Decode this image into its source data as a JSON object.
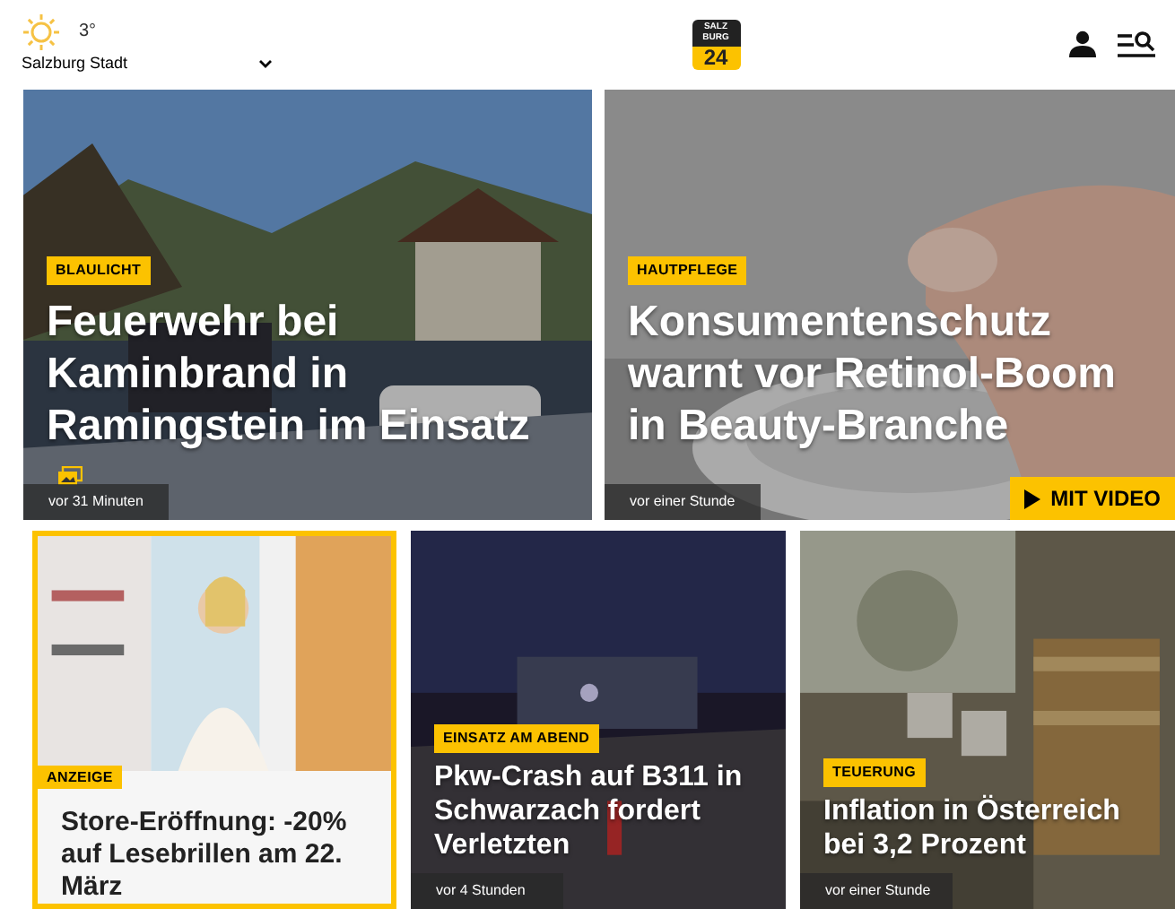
{
  "header": {
    "weather": {
      "temperature": "3°",
      "location": "Salzburg Stadt"
    },
    "logo": {
      "top": "SALZ",
      "middle": "BURG",
      "number": "24"
    }
  },
  "articles": [
    {
      "kind": "feature",
      "tag": "BLAULICHT",
      "title": "Feuerwehr bei Kaminbrand in Ramingstein im Einsatz",
      "time": "vor 31 Minuten",
      "gallery": true
    },
    {
      "kind": "feature",
      "tag": "HAUTPFLEGE",
      "title": "Konsumentenschutz warnt vor Retinol-Boom in Beauty-Branche",
      "time": "vor einer Stunde",
      "video": "MIT VIDEO"
    },
    {
      "kind": "ad",
      "tag": "ANZEIGE",
      "title": "Store-Eröffnung: -20% auf Lesebrillen am 22. März"
    },
    {
      "kind": "teaser",
      "tag": "EINSATZ AM ABEND",
      "title": "Pkw-Crash auf B311 in Schwarzach fordert Verletzten",
      "time": "vor 4 Stunden"
    },
    {
      "kind": "teaser",
      "tag": "TEUERUNG",
      "title": "Inflation in Österreich bei 3,2 Prozent",
      "time": "vor einer Stunde"
    }
  ]
}
